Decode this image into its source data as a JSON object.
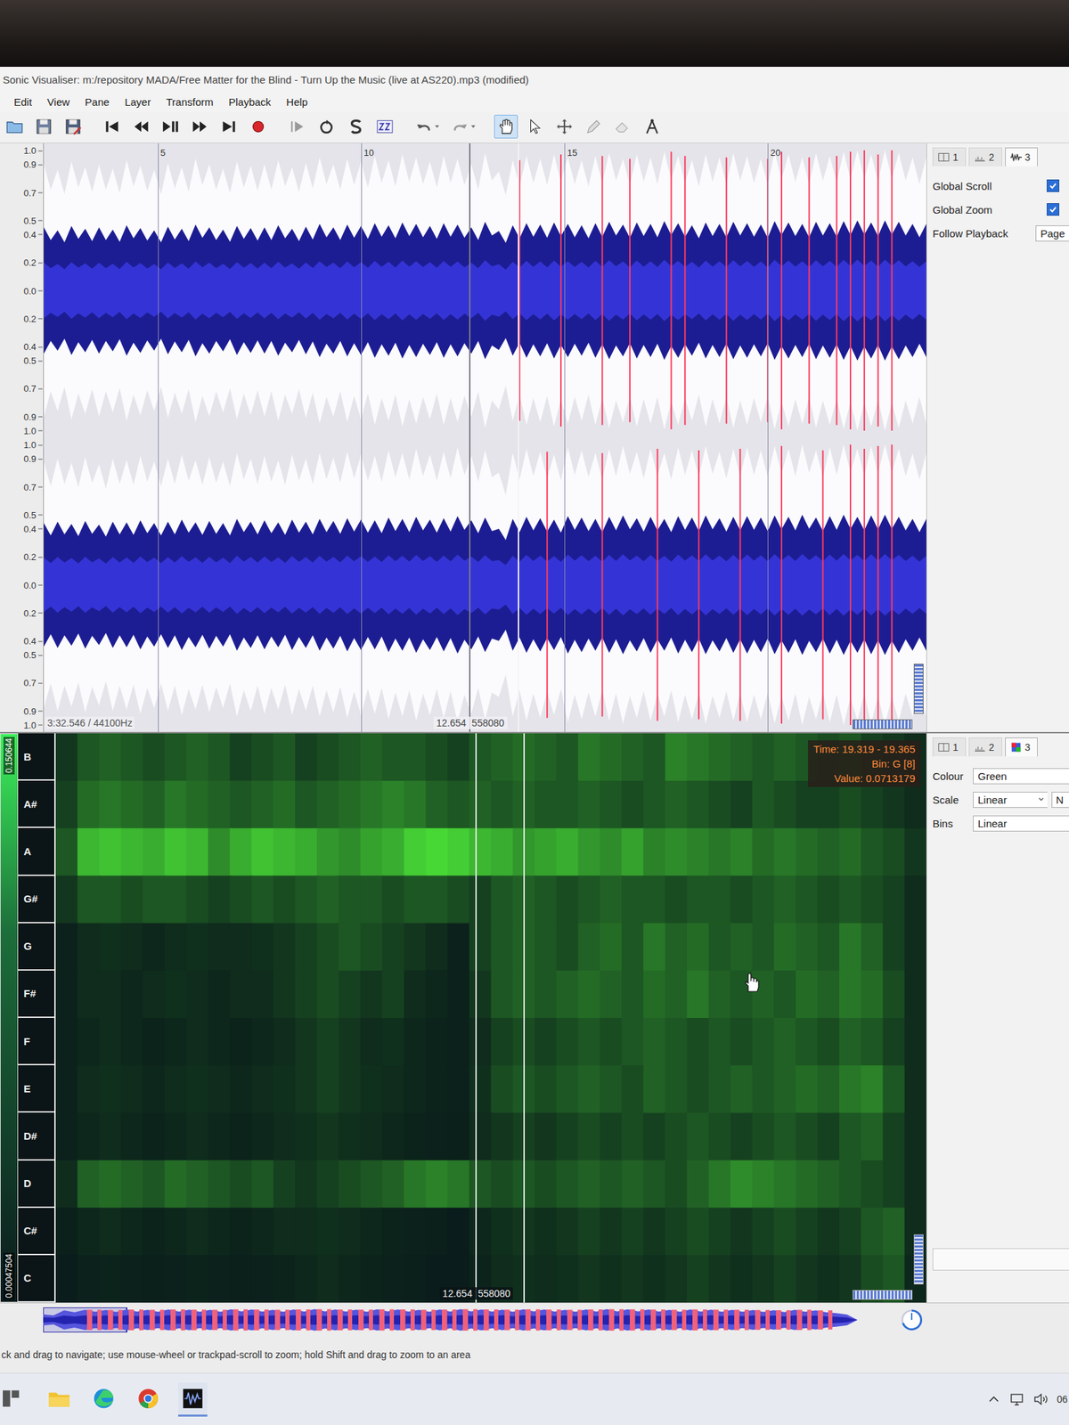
{
  "window": {
    "title": "Sonic Visualiser: m:/repository MADA/Free Matter for the Blind - Turn Up the Music (live at AS220).mp3 (modified)"
  },
  "menu": [
    "Edit",
    "View",
    "Pane",
    "Layer",
    "Transform",
    "Playback",
    "Help"
  ],
  "toolbar": [
    [
      {
        "kind": "open",
        "selected": false
      },
      {
        "kind": "save",
        "selected": false
      },
      {
        "kind": "save-as",
        "selected": false
      }
    ],
    [
      {
        "kind": "jump-start",
        "selected": false
      },
      {
        "kind": "rewind",
        "selected": false
      },
      {
        "kind": "play-pause",
        "selected": false
      },
      {
        "kind": "fast-forward",
        "selected": false
      },
      {
        "kind": "jump-end",
        "selected": false
      },
      {
        "kind": "record",
        "selected": false
      }
    ],
    [
      {
        "kind": "play-selection",
        "selected": false
      },
      {
        "kind": "loop",
        "selected": false
      },
      {
        "kind": "solo",
        "selected": false
      },
      {
        "kind": "normalize",
        "selected": false
      }
    ],
    [
      {
        "kind": "undo",
        "selected": false
      },
      {
        "kind": "redo",
        "selected": false
      }
    ],
    [
      {
        "kind": "navigate",
        "selected": true
      },
      {
        "kind": "select",
        "selected": false
      },
      {
        "kind": "move",
        "selected": false
      },
      {
        "kind": "draw",
        "selected": false
      },
      {
        "kind": "erase",
        "selected": false
      },
      {
        "kind": "measure",
        "selected": false
      }
    ]
  ],
  "waveform": {
    "axis_ticks": [
      {
        "label": "1.0",
        "value": 1.0
      },
      {
        "label": "0.9",
        "value": 0.9
      },
      {
        "label": "0.7",
        "value": 0.7
      },
      {
        "label": "0.5",
        "value": 0.5
      },
      {
        "label": "0.4",
        "value": 0.4
      },
      {
        "label": "0.2",
        "value": 0.2
      },
      {
        "label": "0.0",
        "value": 0.0
      },
      {
        "label": "0.2",
        "value": -0.2
      },
      {
        "label": "0.4",
        "value": -0.4
      },
      {
        "label": "0.5",
        "value": -0.5
      },
      {
        "label": "0.7",
        "value": -0.7
      },
      {
        "label": "0.9",
        "value": -0.9
      },
      {
        "label": "1.0",
        "value": -1.0
      }
    ],
    "time_ticks": [
      "5",
      "10",
      "15",
      "20"
    ],
    "info": "3:32.546 / 44100Hz",
    "cursor_time": "12.654",
    "cursor_frame": "558080",
    "play_pointer": 13.85,
    "channels": [
      {
        "peaks": [
          0.9,
          0.86,
          0.92,
          0.88,
          0.9,
          0.87,
          0.93,
          0.89,
          0.86,
          0.91,
          0.88,
          0.94,
          0.9,
          0.87,
          0.92,
          0.89,
          0.9,
          0.93,
          0.88,
          0.91,
          0.95,
          0.9,
          0.94,
          0.92,
          0.96,
          0.93,
          0.97,
          0.95,
          0.92,
          0.96,
          0.94,
          0.9,
          0.98,
          0.85,
          0.93,
          0.96,
          0.94,
          0.97,
          0.95,
          0.93,
          0.96,
          0.98,
          0.94,
          0.97,
          0.95,
          0.99,
          0.96,
          0.93,
          0.97,
          0.95,
          0.98,
          0.96,
          0.94,
          0.99,
          0.97,
          0.95,
          0.98,
          0.96,
          0.99,
          1.0,
          0.97,
          1.0,
          0.98,
          0.95
        ],
        "clipped": [
          34,
          37,
          40,
          42,
          45,
          46,
          49,
          52,
          53,
          55,
          57,
          58,
          59,
          60,
          61
        ]
      },
      {
        "peaks": [
          0.88,
          0.9,
          0.87,
          0.91,
          0.86,
          0.9,
          0.89,
          0.92,
          0.88,
          0.9,
          0.93,
          0.89,
          0.91,
          0.88,
          0.94,
          0.9,
          0.92,
          0.89,
          0.93,
          0.9,
          0.94,
          0.91,
          0.95,
          0.93,
          0.92,
          0.96,
          0.94,
          0.97,
          0.93,
          0.95,
          0.98,
          0.92,
          0.96,
          0.8,
          0.94,
          0.97,
          0.95,
          0.93,
          0.98,
          0.96,
          0.94,
          0.97,
          0.99,
          0.95,
          0.97,
          0.94,
          0.98,
          0.96,
          0.99,
          0.95,
          0.97,
          0.98,
          0.96,
          0.99,
          0.97,
          1.0,
          0.96,
          0.98,
          1.0,
          0.97,
          0.99,
          1.0,
          0.97,
          0.94
        ],
        "clipped": [
          36,
          40,
          44,
          47,
          50,
          53,
          56,
          58,
          59,
          60,
          61
        ]
      }
    ]
  },
  "waveform_panel": {
    "tabs": [
      {
        "label": "1",
        "kind": "pane",
        "selected": false
      },
      {
        "label": "2",
        "kind": "layers",
        "selected": false
      },
      {
        "label": "3",
        "kind": "waveform",
        "selected": true
      }
    ],
    "options": [
      {
        "kind": "checkbox",
        "label": "Global Scroll",
        "checked": true
      },
      {
        "kind": "checkbox",
        "label": "Global Zoom",
        "checked": true
      },
      {
        "kind": "select",
        "label": "Follow Playback",
        "value": "Page"
      }
    ]
  },
  "chromagram": {
    "scale_max": "0.150644",
    "scale_min": "0.00047504",
    "cursor_time": "12.654",
    "cursor_frame": "558080",
    "play_pointer": 13.85,
    "tooltip": [
      "Time: 19.319 - 19.365",
      "Bin: G [8]",
      "Value: 0.0713179"
    ],
    "bins": [
      {
        "label": "B",
        "levels": [
          0.15,
          0.3,
          0.35,
          0.3,
          0.25,
          0.3,
          0.35,
          0.3,
          0.2,
          0.25,
          0.3,
          0.2,
          0.25,
          0.3,
          0.35,
          0.3,
          0.3,
          0.25,
          0.2,
          0.3,
          0.35,
          0.4,
          0.35,
          0.3,
          0.45,
          0.4,
          0.35,
          0.3,
          0.5,
          0.45,
          0.4,
          0.35,
          0.3,
          0.35,
          0.3,
          0.25,
          0.3,
          0.2,
          0.15,
          0.1
        ]
      },
      {
        "label": "A#",
        "levels": [
          0.2,
          0.4,
          0.45,
          0.4,
          0.35,
          0.45,
          0.4,
          0.35,
          0.3,
          0.35,
          0.4,
          0.3,
          0.35,
          0.4,
          0.45,
          0.5,
          0.45,
          0.35,
          0.3,
          0.35,
          0.3,
          0.35,
          0.3,
          0.3,
          0.35,
          0.3,
          0.25,
          0.3,
          0.35,
          0.3,
          0.25,
          0.2,
          0.3,
          0.25,
          0.2,
          0.2,
          0.25,
          0.2,
          0.15,
          0.1
        ]
      },
      {
        "label": "A",
        "levels": [
          0.3,
          0.75,
          0.8,
          0.75,
          0.7,
          0.8,
          0.75,
          0.55,
          0.7,
          0.8,
          0.75,
          0.7,
          0.6,
          0.55,
          0.65,
          0.7,
          0.85,
          0.9,
          0.85,
          0.75,
          0.7,
          0.6,
          0.65,
          0.7,
          0.6,
          0.55,
          0.65,
          0.5,
          0.55,
          0.5,
          0.45,
          0.5,
          0.4,
          0.45,
          0.4,
          0.35,
          0.4,
          0.3,
          0.25,
          0.15
        ]
      },
      {
        "label": "G#",
        "levels": [
          0.15,
          0.3,
          0.3,
          0.25,
          0.3,
          0.3,
          0.25,
          0.2,
          0.25,
          0.3,
          0.25,
          0.3,
          0.35,
          0.3,
          0.3,
          0.25,
          0.3,
          0.3,
          0.25,
          0.2,
          0.3,
          0.35,
          0.3,
          0.25,
          0.3,
          0.35,
          0.3,
          0.3,
          0.25,
          0.3,
          0.3,
          0.25,
          0.3,
          0.35,
          0.3,
          0.25,
          0.3,
          0.25,
          0.2,
          0.1
        ]
      },
      {
        "label": "G",
        "levels": [
          0.05,
          0.1,
          0.12,
          0.1,
          0.08,
          0.1,
          0.12,
          0.1,
          0.1,
          0.12,
          0.15,
          0.2,
          0.25,
          0.3,
          0.25,
          0.2,
          0.15,
          0.1,
          0.05,
          0.2,
          0.3,
          0.35,
          0.3,
          0.25,
          0.35,
          0.4,
          0.3,
          0.45,
          0.35,
          0.4,
          0.3,
          0.35,
          0.3,
          0.4,
          0.35,
          0.3,
          0.45,
          0.35,
          0.2,
          0.1
        ]
      },
      {
        "label": "F#",
        "levels": [
          0.05,
          0.1,
          0.1,
          0.08,
          0.1,
          0.12,
          0.1,
          0.08,
          0.1,
          0.1,
          0.15,
          0.2,
          0.25,
          0.2,
          0.15,
          0.2,
          0.1,
          0.08,
          0.05,
          0.15,
          0.3,
          0.35,
          0.3,
          0.35,
          0.4,
          0.35,
          0.3,
          0.4,
          0.35,
          0.45,
          0.35,
          0.3,
          0.35,
          0.3,
          0.4,
          0.35,
          0.45,
          0.4,
          0.25,
          0.1
        ]
      },
      {
        "label": "F",
        "levels": [
          0.05,
          0.08,
          0.1,
          0.08,
          0.06,
          0.08,
          0.1,
          0.08,
          0.06,
          0.08,
          0.1,
          0.15,
          0.2,
          0.15,
          0.1,
          0.12,
          0.08,
          0.06,
          0.05,
          0.1,
          0.2,
          0.25,
          0.2,
          0.25,
          0.3,
          0.25,
          0.3,
          0.35,
          0.3,
          0.25,
          0.3,
          0.25,
          0.3,
          0.35,
          0.3,
          0.25,
          0.35,
          0.3,
          0.2,
          0.1
        ]
      },
      {
        "label": "E",
        "levels": [
          0.05,
          0.1,
          0.12,
          0.1,
          0.08,
          0.1,
          0.12,
          0.1,
          0.08,
          0.1,
          0.12,
          0.15,
          0.2,
          0.15,
          0.12,
          0.1,
          0.08,
          0.06,
          0.05,
          0.12,
          0.25,
          0.3,
          0.25,
          0.3,
          0.35,
          0.3,
          0.25,
          0.35,
          0.3,
          0.25,
          0.3,
          0.35,
          0.3,
          0.35,
          0.4,
          0.35,
          0.45,
          0.5,
          0.3,
          0.1
        ]
      },
      {
        "label": "D#",
        "levels": [
          0.05,
          0.08,
          0.1,
          0.08,
          0.06,
          0.08,
          0.1,
          0.08,
          0.06,
          0.08,
          0.1,
          0.12,
          0.15,
          0.12,
          0.1,
          0.08,
          0.06,
          0.05,
          0.04,
          0.1,
          0.15,
          0.2,
          0.15,
          0.2,
          0.25,
          0.2,
          0.25,
          0.2,
          0.25,
          0.3,
          0.25,
          0.2,
          0.25,
          0.3,
          0.25,
          0.2,
          0.3,
          0.35,
          0.2,
          0.1
        ]
      },
      {
        "label": "D",
        "levels": [
          0.1,
          0.35,
          0.4,
          0.35,
          0.3,
          0.4,
          0.35,
          0.3,
          0.25,
          0.3,
          0.2,
          0.15,
          0.2,
          0.25,
          0.3,
          0.35,
          0.45,
          0.5,
          0.45,
          0.3,
          0.25,
          0.3,
          0.25,
          0.3,
          0.35,
          0.3,
          0.35,
          0.3,
          0.25,
          0.35,
          0.45,
          0.55,
          0.5,
          0.45,
          0.4,
          0.35,
          0.3,
          0.25,
          0.2,
          0.1
        ]
      },
      {
        "label": "C#",
        "levels": [
          0.04,
          0.08,
          0.1,
          0.08,
          0.06,
          0.08,
          0.1,
          0.08,
          0.06,
          0.08,
          0.1,
          0.1,
          0.12,
          0.1,
          0.08,
          0.06,
          0.05,
          0.04,
          0.03,
          0.08,
          0.12,
          0.15,
          0.12,
          0.15,
          0.2,
          0.15,
          0.2,
          0.15,
          0.2,
          0.25,
          0.2,
          0.15,
          0.2,
          0.25,
          0.2,
          0.15,
          0.2,
          0.3,
          0.35,
          0.1
        ]
      },
      {
        "label": "C",
        "levels": [
          0.03,
          0.05,
          0.06,
          0.05,
          0.04,
          0.05,
          0.06,
          0.05,
          0.04,
          0.05,
          0.06,
          0.08,
          0.1,
          0.08,
          0.06,
          0.05,
          0.04,
          0.03,
          0.03,
          0.06,
          0.1,
          0.12,
          0.1,
          0.12,
          0.15,
          0.12,
          0.15,
          0.12,
          0.15,
          0.2,
          0.15,
          0.12,
          0.15,
          0.2,
          0.15,
          0.12,
          0.15,
          0.25,
          0.3,
          0.08
        ]
      }
    ]
  },
  "chroma_panel": {
    "tabs": [
      {
        "label": "1",
        "kind": "pane",
        "selected": false
      },
      {
        "label": "2",
        "kind": "layers",
        "selected": false
      },
      {
        "label": "3",
        "kind": "colour-3d",
        "selected": true
      }
    ],
    "properties": [
      {
        "label": "Colour",
        "value": "Green",
        "arrow": false,
        "extra": ""
      },
      {
        "label": "Scale",
        "value": "Linear",
        "arrow": true,
        "extra": "N"
      },
      {
        "label": "Bins",
        "value": "Linear",
        "arrow": false,
        "extra": ""
      }
    ]
  },
  "overview": {
    "peaks": [
      0.5,
      0.85,
      0.9,
      0.88,
      0.92,
      0.9,
      0.93,
      0.91,
      0.9,
      0.94,
      0.92,
      0.9,
      0.93,
      0.95,
      0.92,
      0.91,
      0.94,
      0.93,
      0.9,
      0.92,
      0.95,
      0.93,
      0.91,
      0.94,
      0.92,
      0.9,
      0.93,
      0.95,
      0.94,
      0.92,
      0.9,
      0.93,
      0.91,
      0.9,
      0.88,
      0.86,
      0.9,
      0.85,
      0.6,
      0.0
    ],
    "clipped": [
      2,
      3,
      4,
      5,
      6,
      7,
      8,
      9,
      10,
      11,
      12,
      13,
      14,
      15,
      16,
      17,
      18,
      19,
      20,
      21,
      22,
      23,
      24,
      25,
      26,
      27,
      28,
      29,
      30,
      31,
      32,
      33,
      34,
      35,
      36,
      37
    ],
    "viewport_start": 0.0,
    "viewport_end": 0.1
  },
  "status_bar": {
    "text": "ck and drag to navigate; use mouse-wheel or trackpad-scroll to zoom; hold Shift and drag to zoom to an area"
  },
  "taskbar": {
    "apps": [
      {
        "kind": "start",
        "selected": false
      },
      {
        "kind": "explorer",
        "selected": false
      },
      {
        "kind": "edge",
        "selected": false
      },
      {
        "kind": "chrome",
        "selected": false
      },
      {
        "kind": "sonic-visualiser",
        "selected": true
      }
    ],
    "tray": [
      {
        "kind": "chevron"
      },
      {
        "kind": "network"
      },
      {
        "kind": "volume"
      }
    ],
    "clock": "06"
  }
}
